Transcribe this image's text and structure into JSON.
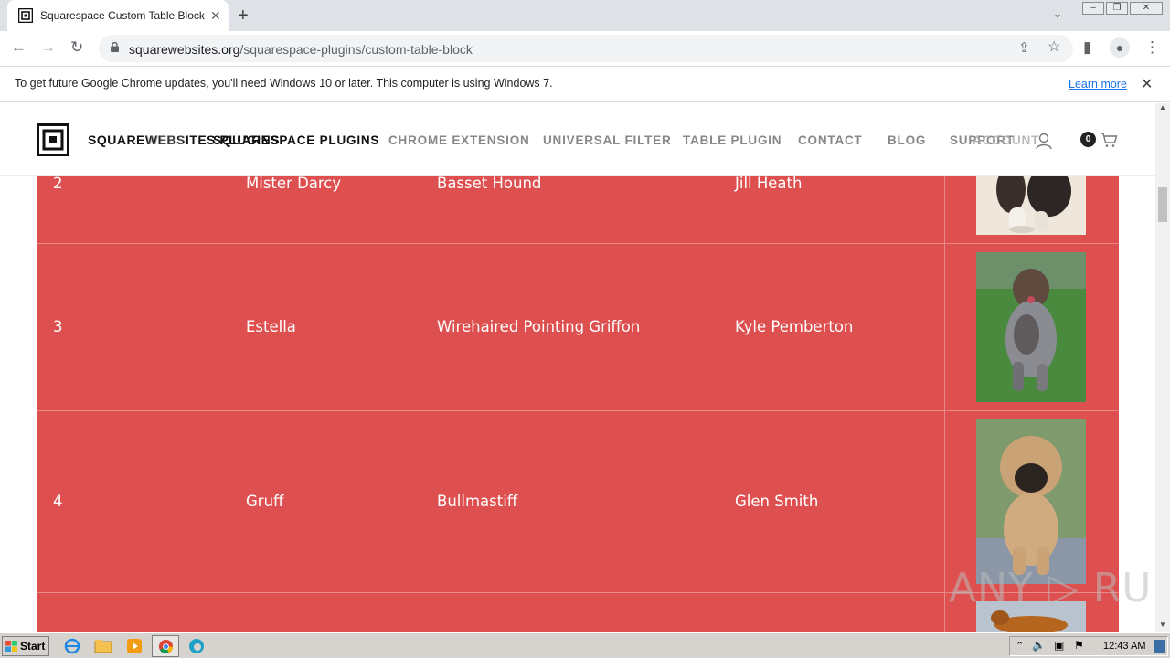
{
  "browser": {
    "tab_title": "Squarespace Custom Table Block Plu",
    "new_tab_label": "+",
    "close_tab_label": "✕",
    "url_host": "squarewebsites.org",
    "url_path": "/squarespace-plugins/custom-table-block"
  },
  "infobar": {
    "message": "To get future Google Chrome updates, you'll need Windows 10 or later. This computer is using Windows 7.",
    "link": "Learn more",
    "close": "✕"
  },
  "site": {
    "brand": "SQUAREWEBSITES PLUGINS",
    "brand_ghost": "WEBS",
    "nav": [
      "SQUARESPACE PLUGINS",
      "CHROME EXTENSION",
      "UNIVERSAL FILTER",
      "TABLE PLUGIN",
      "CONTACT",
      "BLOG",
      "SUPPORT"
    ],
    "account": "ACCOUNT",
    "cart_count": "0"
  },
  "table": {
    "rows": [
      {
        "num": "2",
        "name": "Mister Darcy",
        "breed": "Basset Hound",
        "owner": "Jill Heath"
      },
      {
        "num": "3",
        "name": "Estella",
        "breed": "Wirehaired Pointing Griffon",
        "owner": "Kyle Pemberton"
      },
      {
        "num": "4",
        "name": "Gruff",
        "breed": "Bullmastiff",
        "owner": "Glen Smith"
      }
    ]
  },
  "watermark": "ANY ▷ RUN",
  "taskbar": {
    "start": "Start",
    "clock": "12:43 AM"
  },
  "colors": {
    "table_bg": "#de4f4f",
    "link_blue": "#1a73e8"
  }
}
